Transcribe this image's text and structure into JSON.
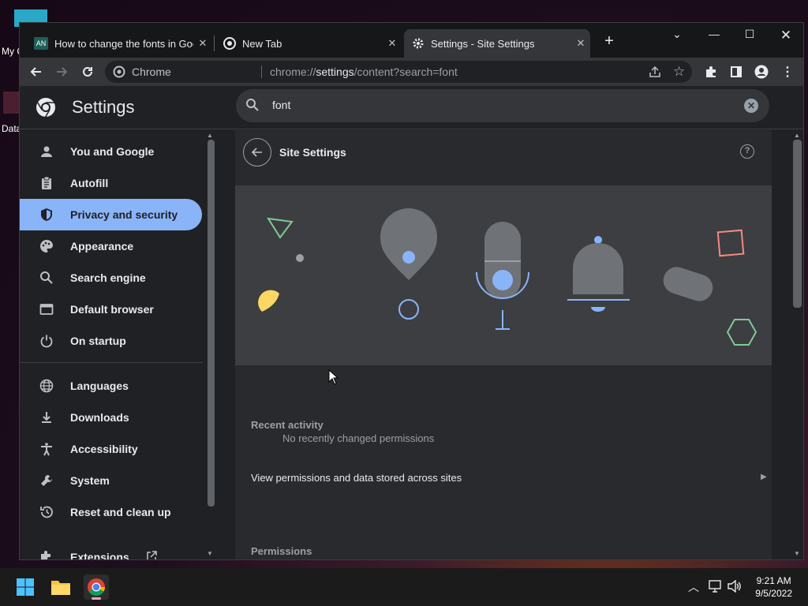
{
  "desktop": {
    "icon1_label": "My C",
    "icon2_label": "Data"
  },
  "browser": {
    "tabs": [
      {
        "title": "How to change the fonts in Goog",
        "favicon_text": "AN",
        "active": false
      },
      {
        "title": "New Tab",
        "active": false
      },
      {
        "title": "Settings - Site Settings",
        "active": true
      }
    ],
    "omnibox": {
      "site_label": "Chrome",
      "url_prefix": "chrome://",
      "url_host": "settings",
      "url_path": "/content?search=font"
    }
  },
  "settings": {
    "app_title": "Settings",
    "search_value": "font",
    "nav": [
      {
        "label": "You and Google",
        "icon": "person-icon"
      },
      {
        "label": "Autofill",
        "icon": "clipboard-icon"
      },
      {
        "label": "Privacy and security",
        "icon": "shield-icon",
        "selected": true
      },
      {
        "label": "Appearance",
        "icon": "palette-icon"
      },
      {
        "label": "Search engine",
        "icon": "search-icon"
      },
      {
        "label": "Default browser",
        "icon": "browser-window-icon"
      },
      {
        "label": "On startup",
        "icon": "power-icon"
      },
      {
        "label": "Languages",
        "icon": "globe-icon"
      },
      {
        "label": "Downloads",
        "icon": "download-icon"
      },
      {
        "label": "Accessibility",
        "icon": "accessibility-icon"
      },
      {
        "label": "System",
        "icon": "wrench-icon"
      },
      {
        "label": "Reset and clean up",
        "icon": "history-icon"
      },
      {
        "label": "Extensions",
        "icon": "puzzle-icon"
      }
    ],
    "page": {
      "title": "Site Settings",
      "recent_activity_heading": "Recent activity",
      "no_recent": "No recently changed permissions",
      "view_permissions": "View permissions and data stored across sites",
      "permissions_heading": "Permissions"
    }
  },
  "taskbar": {
    "time": "9:21 AM",
    "date": "9/5/2022"
  },
  "colors": {
    "accent": "#8ab4f8",
    "background": "#202124",
    "card": "#292a2d"
  }
}
